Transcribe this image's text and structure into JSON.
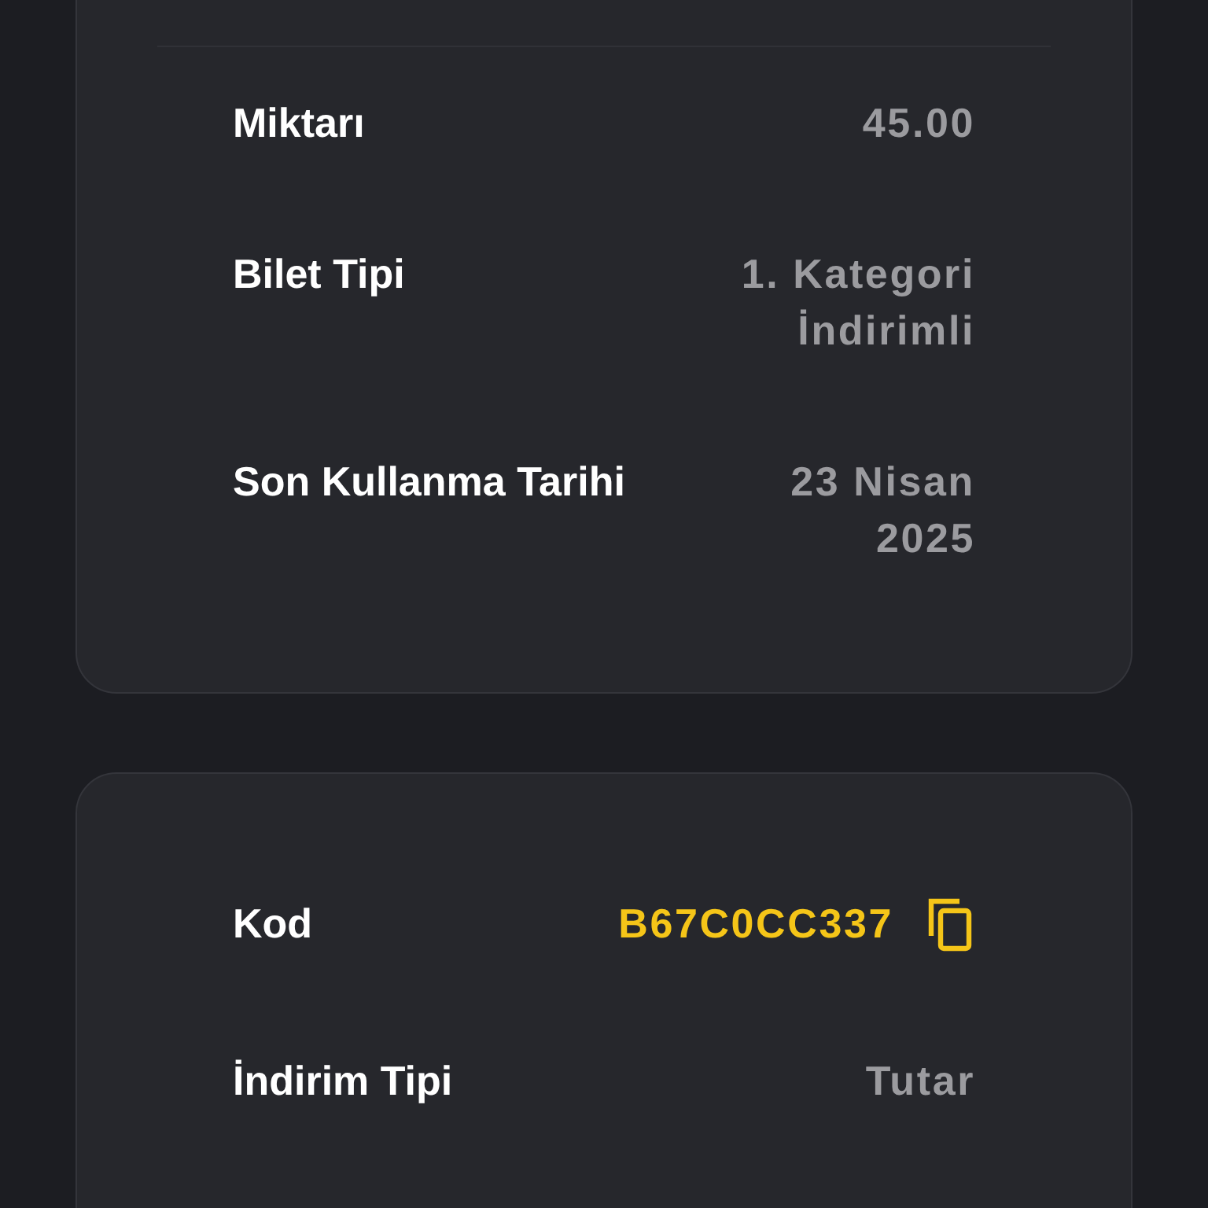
{
  "cards": [
    {
      "rows": [
        {
          "kind": "text",
          "label": "Miktarı",
          "value": "45.00"
        },
        {
          "kind": "text",
          "label": "Bilet Tipi",
          "value": "1. Kategori İndirimli"
        },
        {
          "kind": "text",
          "label": "Son Kullanma Tarihi",
          "value": "23 Nisan 2025"
        }
      ]
    },
    {
      "rows": [
        {
          "kind": "code",
          "label": "Kod",
          "value": "B67C0CC337"
        },
        {
          "kind": "text",
          "label": "İndirim Tipi",
          "value": "Tutar"
        }
      ]
    }
  ]
}
